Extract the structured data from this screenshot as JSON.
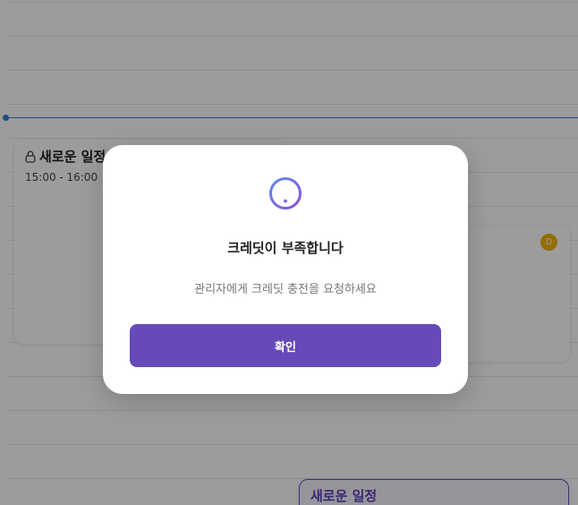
{
  "calendar": {
    "event_a": {
      "title": "새로운 일정",
      "time": "15:00 - 16:00",
      "icon": "lock-icon"
    },
    "event_b": {
      "avatar_initial": "D",
      "avatar_color": "#f0b400"
    },
    "event_c": {
      "title": "새로운 일정"
    },
    "now_line_color": "#2f7fe0"
  },
  "modal": {
    "icon": "alert-circle-icon",
    "title": "크레딧이 부족합니다",
    "message": "관리자에게 크레딧 충전을 요청하세요",
    "confirm_label": "확인",
    "accent_color": "#6749b9"
  }
}
